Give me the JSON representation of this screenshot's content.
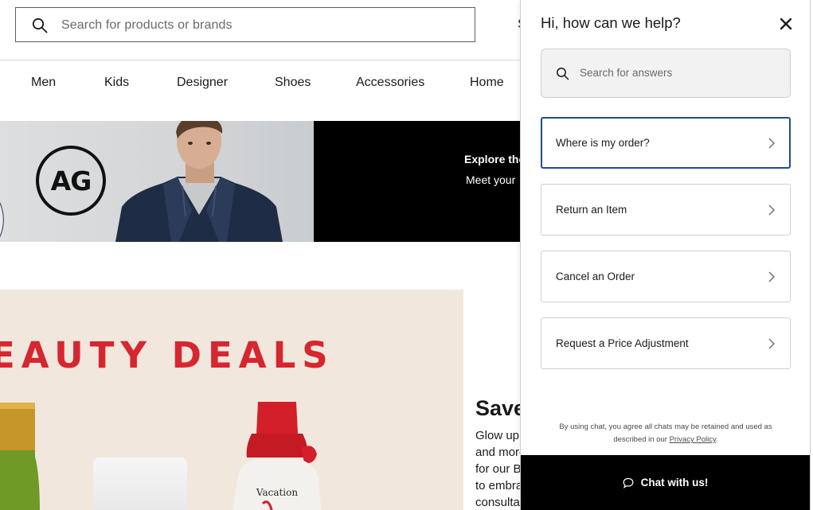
{
  "header": {
    "search_placeholder": "Search for products or brands",
    "edge_text": "S"
  },
  "nav": {
    "items": [
      "Men",
      "Kids",
      "Designer",
      "Shoes",
      "Accessories",
      "Home"
    ]
  },
  "banner": {
    "logo_text": "AG",
    "line1": "Explore the",
    "line2": "Meet your"
  },
  "promo": {
    "title": "EAUTY DEALS",
    "vacation_brand": "Vacation",
    "save_heading": "Save",
    "body_lines": [
      "Glow up",
      "and more",
      "for our B",
      "to embra",
      "consulta"
    ]
  },
  "help_panel": {
    "title": "Hi, how can we help?",
    "search_placeholder": "Search for answers",
    "options": [
      {
        "label": "Where is my order?"
      },
      {
        "label": "Return an Item"
      },
      {
        "label": "Cancel an Order"
      },
      {
        "label": "Request a Price Adjustment"
      }
    ],
    "disclaimer_line1": "By using chat, you agree all chats may be retained and used as",
    "disclaimer_line2_prefix": "described in our ",
    "privacy_link": "Privacy Policy",
    "disclaimer_line2_suffix": ".",
    "chat_button": "Chat with us!"
  },
  "colors": {
    "active_border": "#1f4e8c",
    "promo_red": "#d6262f",
    "promo_bg": "#f2e7dd",
    "chat_bar": "#000000"
  },
  "icons": [
    "search-icon",
    "close-icon",
    "chevron-right-icon",
    "chat-bubble-icon"
  ]
}
